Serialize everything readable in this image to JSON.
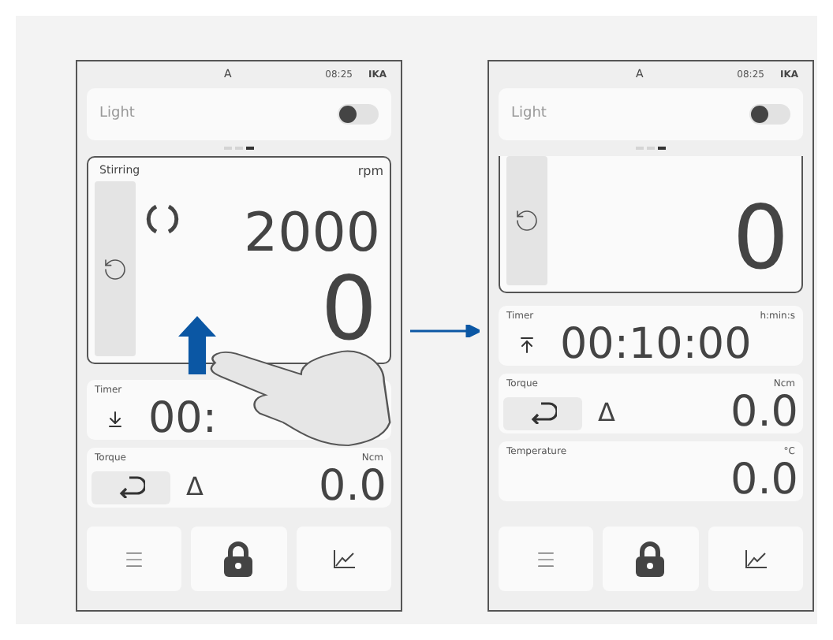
{
  "screens": [
    {
      "status": {
        "left": "A",
        "time": "08:25",
        "logo": "IKA"
      },
      "light": {
        "label": "Light",
        "on": false
      },
      "page_dots": [
        {
          "selected": false
        },
        {
          "selected": false
        },
        {
          "selected": true
        }
      ],
      "cards": [
        {
          "kind": "stirring",
          "label": "Stirring",
          "unit": "rpm",
          "setpoint": "2000",
          "value": "0",
          "full": true
        },
        {
          "kind": "timer",
          "label": "Timer",
          "value": "00:",
          "counting_down": true
        },
        {
          "kind": "torque",
          "label": "Torque",
          "unit": "Ncm",
          "symbol": "Δ",
          "value": "0.0"
        }
      ],
      "gesture": true
    },
    {
      "status": {
        "left": "A",
        "time": "08:25",
        "logo": "IKA"
      },
      "light": {
        "label": "Light",
        "on": false
      },
      "page_dots": [
        {
          "selected": false
        },
        {
          "selected": false
        },
        {
          "selected": true
        }
      ],
      "cards": [
        {
          "kind": "stirring",
          "value": "0",
          "full": false
        },
        {
          "kind": "timer",
          "label": "Timer",
          "unit": "h:min:s",
          "value": "00:10:00",
          "counting_down": false
        },
        {
          "kind": "torque",
          "label": "Torque",
          "unit": "Ncm",
          "symbol": "Δ",
          "value": "0.0"
        },
        {
          "kind": "temperature",
          "label": "Temperature",
          "unit": "°C",
          "value": "0.0"
        }
      ],
      "gesture": false
    }
  ]
}
